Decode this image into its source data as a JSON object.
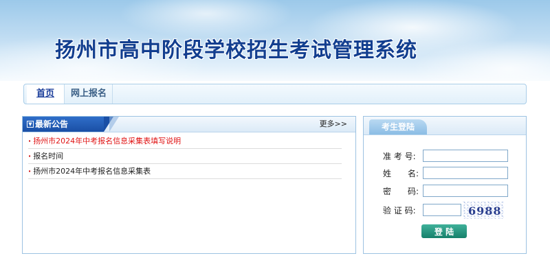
{
  "header": {
    "title": "扬州市高中阶段学校招生考试管理系统"
  },
  "nav": {
    "items": [
      {
        "label": "首页"
      },
      {
        "label": "网上报名"
      }
    ]
  },
  "notice": {
    "title": "最新公告",
    "more": "更多>>",
    "items": [
      {
        "text": "扬州市2024年中考报名信息采集表填写说明",
        "color": "#e01414"
      },
      {
        "text": "报名时间"
      },
      {
        "text": "扬州市2024年中考报名信息采集表"
      }
    ]
  },
  "login": {
    "tab": "考生登陆",
    "fields": {
      "exam_no": {
        "label": "准 考 号:",
        "value": ""
      },
      "name": {
        "label": "姓　　名:",
        "value": ""
      },
      "password": {
        "label": "密　　码:",
        "value": ""
      },
      "captcha": {
        "label": "验 证 码:",
        "value": "",
        "image_text": "6988"
      }
    },
    "button": "登 陆"
  },
  "colors": {
    "title": "#123e8f",
    "notice_tab": "#1a4fa5",
    "login_button": "#16806b",
    "alert_text": "#e01414"
  }
}
